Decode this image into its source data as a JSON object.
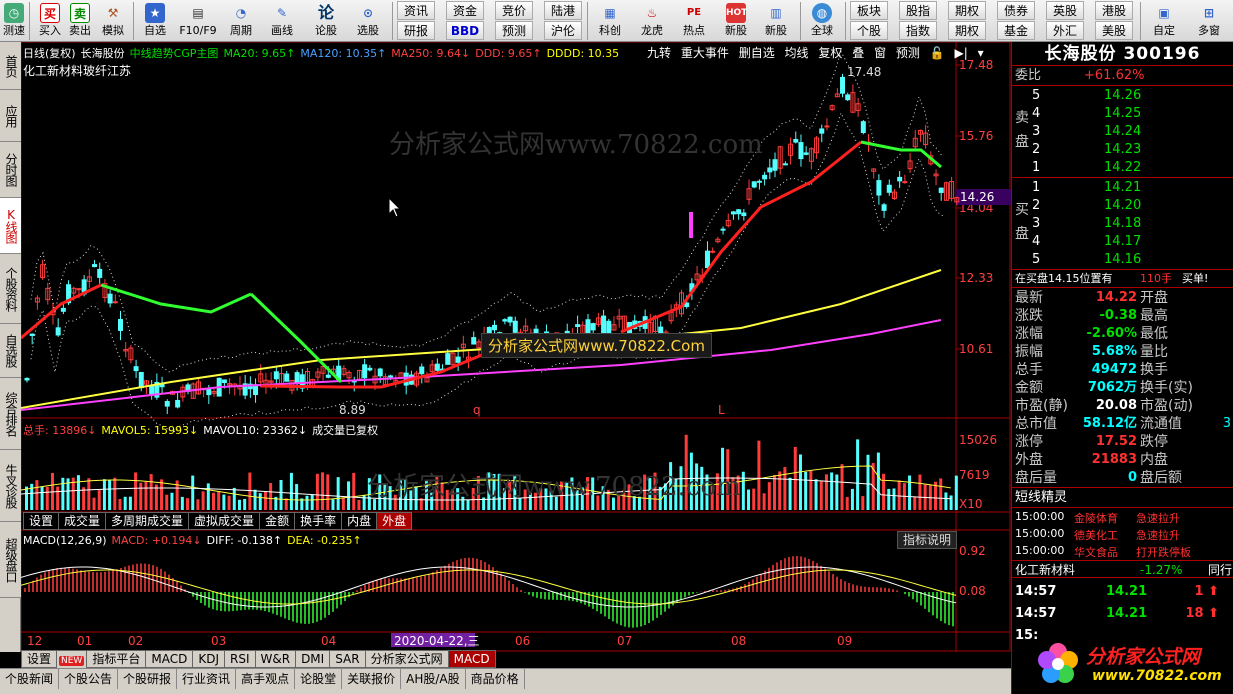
{
  "toolbar": {
    "buttons": [
      {
        "label": "测速",
        "icon": "speed-test-icon"
      },
      {
        "label": "买入",
        "icon": "buy-icon",
        "glyph": "买"
      },
      {
        "label": "卖出",
        "icon": "sell-icon",
        "glyph": "卖"
      },
      {
        "label": "模拟",
        "icon": "gavel-icon"
      },
      {
        "label": "自选",
        "icon": "favorites-icon"
      },
      {
        "label": "F10/F9",
        "icon": "f10-icon"
      },
      {
        "label": "周期",
        "icon": "clock-icon"
      },
      {
        "label": "画线",
        "icon": "pencil-icon"
      },
      {
        "label": "论股",
        "icon": "discuss-icon",
        "glyph": "论"
      },
      {
        "label": "选股",
        "icon": "select-stock-icon"
      }
    ],
    "pairs": [
      {
        "top": "资讯",
        "bottom": "研报"
      },
      {
        "top": "资金",
        "bottom": "BBD"
      },
      {
        "top": "竞价",
        "bottom": "预测"
      },
      {
        "top": "陆港",
        "bottom": "沪伦"
      }
    ],
    "buttons2": [
      {
        "label": "科创",
        "icon": "chart-icon"
      },
      {
        "label": "龙虎",
        "icon": "dragon-icon"
      },
      {
        "label": "热点",
        "icon": "hot-icon"
      },
      {
        "label": "新股",
        "icon": "new-stock-icon"
      }
    ],
    "globe": {
      "label": "全球",
      "icon": "globe-icon"
    },
    "pairs2": [
      {
        "top": "板块",
        "bottom": "个股"
      },
      {
        "top": "股指",
        "bottom": "指数"
      },
      {
        "top": "期权",
        "bottom": "期权"
      },
      {
        "top": "债券",
        "bottom": "基金"
      },
      {
        "top": "英股",
        "bottom": "外汇"
      },
      {
        "top": "港股",
        "bottom": "美股"
      }
    ],
    "right": [
      {
        "label": "自定",
        "icon": "customize-icon"
      },
      {
        "label": "多窗",
        "icon": "multi-window-icon"
      }
    ]
  },
  "sidetabs": [
    "首页",
    "应用",
    "分时图",
    "K线图",
    "个股资料",
    "自选股",
    "综合排名",
    "牛叉诊股",
    "超级盘口"
  ],
  "chart": {
    "title_line": {
      "period": "日线(复权)",
      "name": "长海股份",
      "indicator": "中线趋势CGP主图",
      "ma20": "MA20: 9.65↑",
      "ma120": "MA120: 10.35↑",
      "ma250": "MA250: 9.64↓",
      "ddd": "DDD: 9.65↑",
      "dddd": "DDDD: 10.35"
    },
    "subtitle": "化工新材料玻纤江苏",
    "tools": [
      "九转",
      "重大事件",
      "删自选",
      "均线",
      "复权",
      "叠",
      "窗",
      "预测"
    ],
    "price_labels": [
      "17.48",
      "15.76",
      "14.04",
      "12.33",
      "10.61"
    ],
    "current_price": "14.26",
    "high_label": "17.48",
    "low_label": "8.89",
    "mark_q": "q",
    "mark_l": "L",
    "watermark": "分析家公式网www.70822.com",
    "watermark2": "分析家公式网www.70822.com",
    "banner": "分析家公式网www.70822.Com",
    "vol_line": {
      "total": "总手: 13896↓",
      "mavol5": "MAVOL5: 15993↓",
      "mavol10": "MAVOL10: 23362↓",
      "note": "成交量已复权"
    },
    "vol_labels": [
      "15026",
      "7619",
      "X10"
    ],
    "subtabs": [
      "设置",
      "成交量",
      "多周期成交量",
      "虚拟成交量",
      "金额",
      "换手率",
      "内盘",
      "外盘"
    ],
    "macd_line": {
      "name": "MACD(12,26,9)",
      "macd": "MACD: +0.194↓",
      "diff": "DIFF: -0.138↑",
      "dea": "DEA: -0.235↑"
    },
    "macd_button": "指标说明",
    "macd_labels": [
      "0.92",
      "0.08"
    ],
    "months": [
      "12",
      "01",
      "02",
      "03",
      "04",
      "2020-04-22,三",
      "06",
      "07",
      "08",
      "09"
    ],
    "bottom_tabs": [
      "设置",
      "NEW",
      "指标平台",
      "MACD",
      "KDJ",
      "RSI",
      "W&R",
      "DMI",
      "SAR",
      "分析家公式网",
      "MACD"
    ]
  },
  "statusbar": [
    "个股新闻",
    "个股公告",
    "个股研报",
    "行业资讯",
    "高手观点",
    "论股堂",
    "关联报价",
    "AH股/A股",
    "商品价格"
  ],
  "panel": {
    "title": "长海股份 300196",
    "weibi_label": "委比",
    "weibi": "+61.62%",
    "sell_label": "卖盘",
    "buy_label": "买盘",
    "asks": [
      {
        "lv": "5",
        "p": "14.26"
      },
      {
        "lv": "4",
        "p": "14.25"
      },
      {
        "lv": "3",
        "p": "14.24"
      },
      {
        "lv": "2",
        "p": "14.23"
      },
      {
        "lv": "1",
        "p": "14.22"
      }
    ],
    "bids": [
      {
        "lv": "1",
        "p": "14.21"
      },
      {
        "lv": "2",
        "p": "14.20"
      },
      {
        "lv": "3",
        "p": "14.18"
      },
      {
        "lv": "4",
        "p": "14.17"
      },
      {
        "lv": "5",
        "p": "14.16"
      }
    ],
    "bid_note": "在买盘14.15位置有",
    "bid_note_qty": "110手",
    "bid_note_tag": "买单!",
    "stats": [
      {
        "l": "最新",
        "v": "14.22",
        "c": "red",
        "r": "开盘"
      },
      {
        "l": "涨跌",
        "v": "-0.38",
        "c": "green",
        "r": "最高"
      },
      {
        "l": "涨幅",
        "v": "-2.60%",
        "c": "green",
        "r": "最低"
      },
      {
        "l": "振幅",
        "v": "5.68%",
        "c": "cyan",
        "r": "量比"
      },
      {
        "l": "总手",
        "v": "49472",
        "c": "cyan",
        "r": "换手"
      },
      {
        "l": "金额",
        "v": "7062万",
        "c": "cyan",
        "r": "换手(实)"
      },
      {
        "l": "市盈(静)",
        "v": "20.08",
        "c": "white",
        "r": "市盈(动)"
      },
      {
        "l": "总市值",
        "v": "58.12亿",
        "c": "cyan",
        "r": "流通值"
      },
      {
        "l": "涨停",
        "v": "17.52",
        "c": "red",
        "r": "跌停"
      },
      {
        "l": "外盘",
        "v": "21883",
        "c": "red",
        "r": "内盘"
      },
      {
        "l": "盘后量",
        "v": "0",
        "c": "cyan",
        "r": "盘后额"
      }
    ],
    "stats_trail": "3",
    "elf_title": "短线精灵",
    "elf": [
      {
        "t": "15:00:00",
        "n": "金陵体育",
        "a": "急速拉升"
      },
      {
        "t": "15:00:00",
        "n": "德美化工",
        "a": "急速拉升"
      },
      {
        "t": "15:00:00",
        "n": "华文食品",
        "a": "打开跌停板"
      }
    ],
    "sector": {
      "name": "化工新材料",
      "pct": "-1.27%",
      "tab": "同行"
    },
    "ticks": [
      {
        "t": "14:57",
        "p": "14.21",
        "q": "1"
      },
      {
        "t": "14:57",
        "p": "14.21",
        "q": "18"
      },
      {
        "t": "15:",
        "p": "",
        "q": ""
      }
    ],
    "logo_text": "分析家公式网",
    "logo_url": "www.70822.com"
  }
}
